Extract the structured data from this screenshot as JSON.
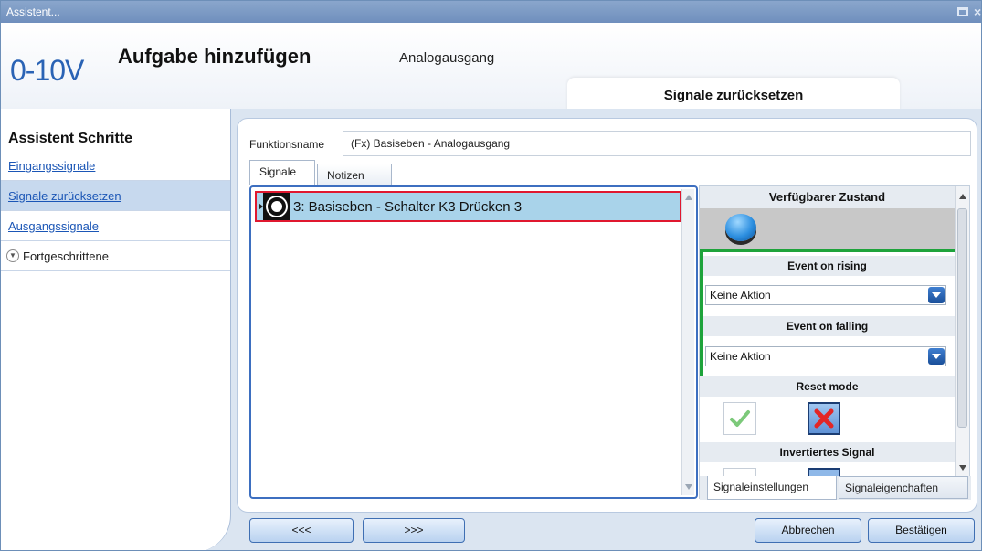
{
  "window": {
    "title": "Assistent..."
  },
  "header": {
    "logo_text": "0-10V",
    "title": "Aufgabe hinzufügen",
    "subtitle": "Analogausgang",
    "current_step": "Signale zurücksetzen"
  },
  "sidebar": {
    "heading": "Assistent Schritte",
    "items": [
      {
        "label": "Eingangssignale",
        "active": false
      },
      {
        "label": "Signale zurücksetzen",
        "active": true
      },
      {
        "label": "Ausgangssignale",
        "active": false
      }
    ],
    "advanced_label": "Fortgeschrittene"
  },
  "form": {
    "function_name_label": "Funktionsname",
    "function_name_value": "(Fx) Basiseben - Analogausgang"
  },
  "tabs": {
    "signals": "Signale",
    "notes": "Notizen"
  },
  "signals_list": {
    "rows": [
      {
        "text": "3: Basiseben - Schalter K3 Drücken 3",
        "selected": true
      }
    ]
  },
  "right_panel": {
    "available_state_heading": "Verfügbarer Zustand",
    "event_rising_heading": "Event on rising",
    "event_rising_value": "Keine Aktion",
    "event_falling_heading": "Event on falling",
    "event_falling_value": "Keine Aktion",
    "reset_mode_heading": "Reset mode",
    "inverted_signal_heading": "Invertiertes Signal",
    "tab_settings": "Signaleinstellungen",
    "tab_properties": "Signaleigenchaften"
  },
  "footer": {
    "back": "<<<",
    "next": ">>>",
    "cancel": "Abbrechen",
    "confirm": "Bestätigen"
  },
  "colors": {
    "selection_outline": "#e0182f",
    "event_group_outline": "#1ea33b",
    "link": "#1b56b6",
    "logo": "#2a63b5"
  },
  "icons": {
    "window_buttons": [
      "restore-icon",
      "close-icon"
    ],
    "signal_row": "switch-icon",
    "available_state": "blue-button-icon",
    "reset_mode": [
      "checkmark-icon",
      "red-x-icon"
    ],
    "advanced_toggle": "chevron-down-icon",
    "dropdown": "dropdown-arrow-icon"
  }
}
